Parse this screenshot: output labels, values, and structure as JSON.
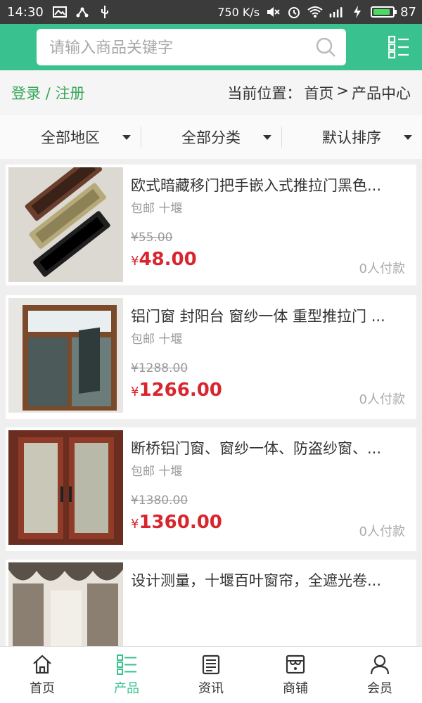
{
  "status_bar": {
    "time": "14:30",
    "speed": "750 K/s",
    "battery": "87",
    "battery_level": 0.87
  },
  "header": {
    "search_placeholder": "请输入商品关键字"
  },
  "crumb": {
    "login": "登录",
    "separator": "/",
    "register": "注册",
    "location_label": "当前位置：",
    "home": "首页",
    "arrow": ">",
    "current": "产品中心"
  },
  "filters": [
    {
      "label": "全部地区"
    },
    {
      "label": "全部分类"
    },
    {
      "label": "默认排序"
    }
  ],
  "products": [
    {
      "name": "欧式暗藏移门把手嵌入式推拉门黑色...",
      "meta": "包邮 十堰",
      "old_price": "55.00",
      "price": "48.00",
      "paid": "0人付款"
    },
    {
      "name": "铝门窗 封阳台 窗纱一体 重型推拉门 ...",
      "meta": "包邮 十堰",
      "old_price": "1288.00",
      "price": "1266.00",
      "paid": "0人付款"
    },
    {
      "name": "断桥铝门窗、窗纱一体、防盗纱窗、...",
      "meta": "包邮 十堰",
      "old_price": "1380.00",
      "price": "1360.00",
      "paid": "0人付款"
    },
    {
      "name": "设计测量，十堰百叶窗帘，全遮光卷...",
      "meta": "",
      "old_price": "",
      "price": "",
      "paid": ""
    }
  ],
  "currency": "¥",
  "nav": [
    {
      "label": "首页",
      "icon": "home-icon"
    },
    {
      "label": "产品",
      "icon": "product-list-icon",
      "active": true
    },
    {
      "label": "资讯",
      "icon": "news-icon"
    },
    {
      "label": "商铺",
      "icon": "shop-icon"
    },
    {
      "label": "会员",
      "icon": "user-icon"
    }
  ],
  "colors": {
    "brand": "#39c28f",
    "price": "#d9262e",
    "login": "#39a85a"
  }
}
